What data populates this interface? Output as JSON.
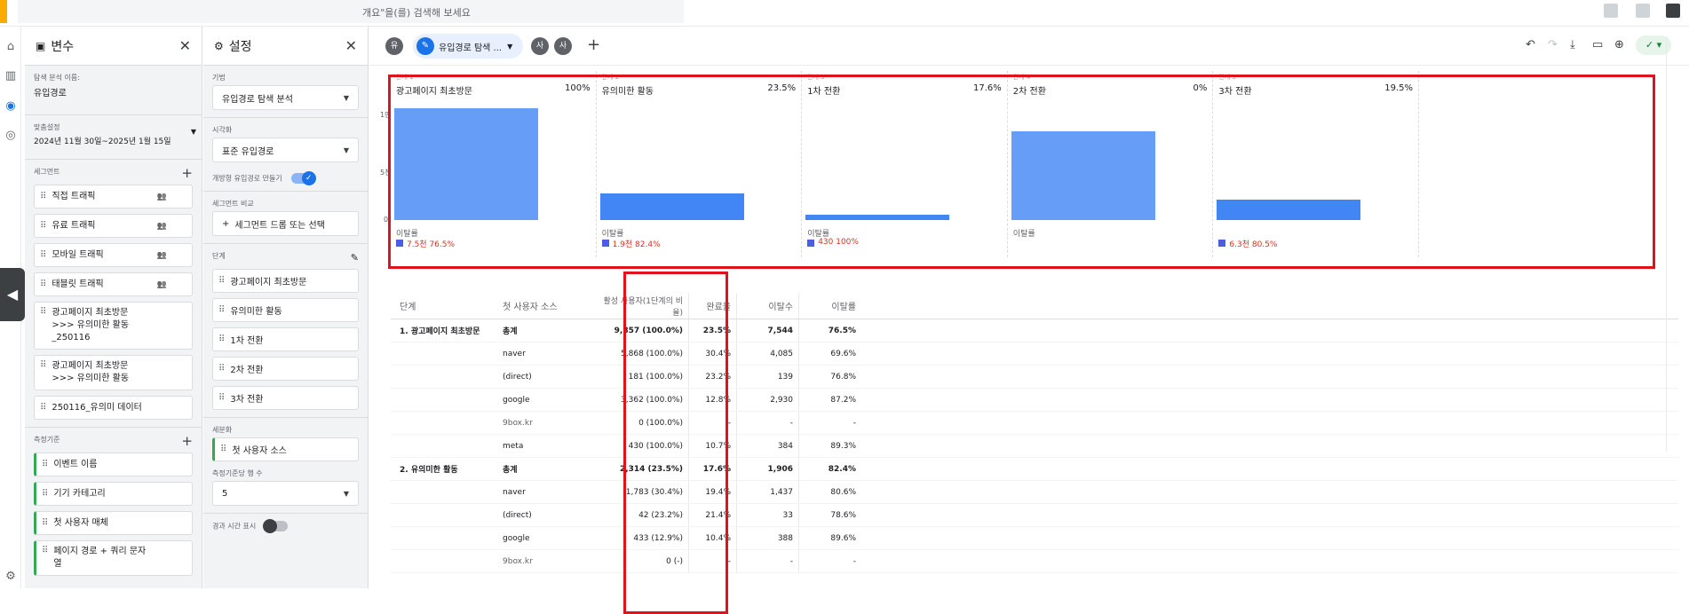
{
  "topbar": {
    "search_placeholder": "개요\"을(를) 검색해 보세요"
  },
  "variables_panel": {
    "title": "변수",
    "exploration_name_label": "탐색 분석 이름:",
    "exploration_name": "유입경로",
    "date_label": "맞춤설정",
    "date_range": "2024년 11월 30일~2025년 1월 15일",
    "segments_label": "세그먼트",
    "segments": [
      "직접 트래픽",
      "유료 트래픽",
      "모바일 트래픽",
      "태블릿 트래픽",
      "광고페이지 최초방문\n>>> 유의미한 활동\n_250116",
      "광고페이지 최초방문\n>>> 유의미한 활동",
      "250116_유의미 데이터"
    ],
    "dimensions_label": "측정기준",
    "dimensions": [
      "이벤트 이름",
      "기기 카테고리",
      "첫 사용자 매체",
      "페이지 경로 + 쿼리 문자\n열"
    ]
  },
  "settings_panel": {
    "title": "설정",
    "technique_label": "기법",
    "technique": "유입경로 탐색 분석",
    "visualization_label": "시각화",
    "visualization": "표준 유입경로",
    "open_funnel_label": "개방형 유입경로 만들기",
    "segment_compare_label": "세그먼트 비교",
    "segment_drop": "세그먼트 드롭 또는 선택",
    "steps_label": "단계",
    "steps": [
      "광고페이지 최초방문",
      "유의미한 활동",
      "1차 전환",
      "2차 전환",
      "3차 전환"
    ],
    "breakdown_label": "세분화",
    "breakdown": "첫 사용자 소스",
    "rows_label": "측정기준당 행 수",
    "rows": "5",
    "elapsed_label": "경과 시간 표시"
  },
  "tabs": {
    "left_badge": "유",
    "active_tab": "유입경로 탐색 ...",
    "badge2": "사",
    "badge3": "사"
  },
  "chart_data": {
    "type": "bar",
    "categories": [
      "광고페이지 최초방문",
      "유의미한 활동",
      "1차 전환",
      "2차 전환",
      "3차 전환"
    ],
    "step_labels": [
      "단계 1",
      "단계 2",
      "단계 3",
      "단계 4",
      "단계 5"
    ],
    "percentages": [
      "100%",
      "23.5%",
      "17.6%",
      "0%",
      "19.5%"
    ],
    "values": [
      9857,
      2314,
      430,
      7800,
      1780
    ],
    "yticks": [
      "1만",
      "5천",
      "0"
    ],
    "ylim": [
      0,
      10000
    ],
    "drop_label": "이탈률",
    "drop_values": [
      "7.5천",
      "1.9천",
      "430",
      "",
      "6.3천"
    ],
    "drop_pcts": [
      "76.5%",
      "82.4%",
      "100%",
      "",
      "80.5%"
    ]
  },
  "table": {
    "headers": [
      "단계",
      "첫 사용자 소스",
      "활성 사용자(1단계의 비율)",
      "완료율",
      "이탈수",
      "이탈률"
    ],
    "rows": [
      [
        "1. 광고페이지 최초방문",
        "총계",
        "9,857 (100.0%)",
        "23.5%",
        "7,544",
        "76.5%"
      ],
      [
        "",
        "naver",
        "5,868 (100.0%)",
        "30.4%",
        "4,085",
        "69.6%"
      ],
      [
        "",
        "(direct)",
        "181 (100.0%)",
        "23.2%",
        "139",
        "76.8%"
      ],
      [
        "",
        "google",
        "3,362 (100.0%)",
        "12.8%",
        "2,930",
        "87.2%"
      ],
      [
        "",
        "9box.kr",
        "0 (100.0%)",
        "-",
        "-",
        "-"
      ],
      [
        "",
        "meta",
        "430 (100.0%)",
        "10.7%",
        "384",
        "89.3%"
      ],
      [
        "2. 유의미한 활동",
        "총계",
        "2,314 (23.5%)",
        "17.6%",
        "1,906",
        "82.4%"
      ],
      [
        "",
        "naver",
        "1,783 (30.4%)",
        "19.4%",
        "1,437",
        "80.6%"
      ],
      [
        "",
        "(direct)",
        "42 (23.2%)",
        "21.4%",
        "33",
        "78.6%"
      ],
      [
        "",
        "google",
        "433 (12.9%)",
        "10.4%",
        "388",
        "89.6%"
      ],
      [
        "",
        "9box.kr",
        "0 (-)",
        "-",
        "-",
        "-"
      ]
    ]
  }
}
